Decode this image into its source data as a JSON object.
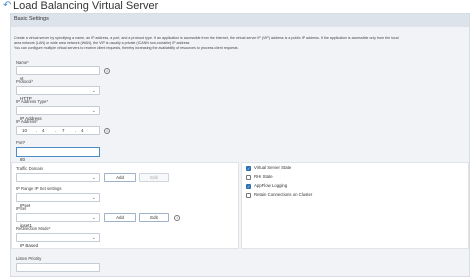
{
  "header": {
    "title": "Load Balancing Virtual Server",
    "back_icon": "back-arrow-icon"
  },
  "section": {
    "title": "Basic Settings"
  },
  "description": [
    "Create a virtual server by specifying a name, an IP address, a port, and a protocol type. If an application is accessible from the Internet, the virtual server IP (VIP) address is a public IP address. If the application is accessible only from the local",
    "area network (LAN) or wide area network (WAN), the VIP is usually a private (ICANN non-routable) IP address.",
    "You can configure multiple virtual servers to receive client requests, thereby increasing the availability of resources to process client requests."
  ],
  "form": {
    "name": {
      "label": "Name*",
      "value": "vt"
    },
    "protocol": {
      "label": "Protocol*",
      "value": "HTTP"
    },
    "ip_type": {
      "label": "IP Address Type*",
      "value": "IP Address"
    },
    "ip_address": {
      "label": "IP Address*",
      "octets": [
        "10",
        "4",
        "7",
        "4"
      ]
    },
    "port": {
      "label": "Port*",
      "value": "80"
    },
    "traffic_domain": {
      "label": "Traffic Domain",
      "value": "",
      "add": "Add",
      "edit": "Edit"
    },
    "range_settings": {
      "label": "IP Range IP Set settings",
      "value": "IPset"
    },
    "ipset": {
      "label": "IPSet",
      "value": "ipset1",
      "add": "Add",
      "edit": "Edit"
    },
    "redirection_mode": {
      "label": "Redirection Mode*",
      "value": "IP Based"
    },
    "listen_priority": {
      "label": "Listen Priority",
      "value": ""
    }
  },
  "options": [
    {
      "label": "Virtual Server State",
      "checked": true
    },
    {
      "label": "RHI State",
      "checked": false
    },
    {
      "label": "AppFlow Logging",
      "checked": true
    },
    {
      "label": "Retain Connections on Cluster",
      "checked": false
    }
  ]
}
